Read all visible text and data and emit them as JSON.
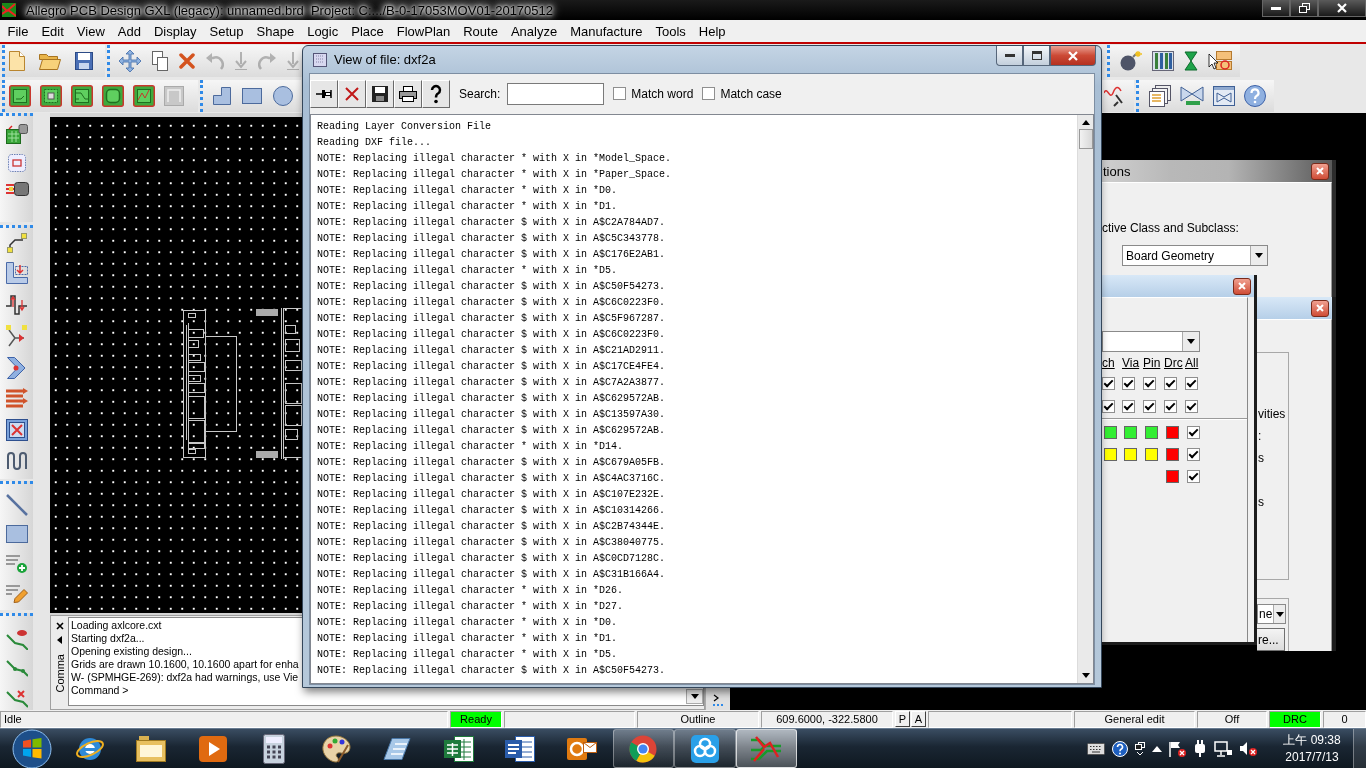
{
  "window": {
    "title": "Allegro PCB Design GXL (legacy): unnamed.brd  Project: C:.../B-0-17053MOV01-20170512"
  },
  "menu": [
    "File",
    "Edit",
    "View",
    "Add",
    "Display",
    "Setup",
    "Shape",
    "Logic",
    "Place",
    "FlowPlan",
    "Route",
    "Analyze",
    "Manufacture",
    "Tools",
    "Help"
  ],
  "edit_toolbar": [
    {
      "kind": "move",
      "disabled": false
    },
    {
      "kind": "copy",
      "disabled": false
    },
    {
      "kind": "delete",
      "disabled": false
    },
    {
      "kind": "undo",
      "disabled": true
    },
    {
      "kind": "step_back",
      "disabled": true
    },
    {
      "kind": "redo",
      "disabled": true
    },
    {
      "kind": "step_forward",
      "disabled": true
    }
  ],
  "viewer": {
    "title": "View of file: dxf2a",
    "search_label": "Search:",
    "options": [
      {
        "label": "Match word",
        "checked": false
      },
      {
        "label": "Match case",
        "checked": false
      }
    ],
    "lines": [
      "Reading Layer Conversion File",
      "Reading DXF file...",
      "NOTE: Replacing illegal character * with X in *Model_Space.",
      "NOTE: Replacing illegal character * with X in *Paper_Space.",
      "NOTE: Replacing illegal character * with X in *D0.",
      "NOTE: Replacing illegal character * with X in *D1.",
      "NOTE: Replacing illegal character $ with X in A$C2A784AD7.",
      "NOTE: Replacing illegal character $ with X in A$C5C343778.",
      "NOTE: Replacing illegal character $ with X in A$C176E2AB1.",
      "NOTE: Replacing illegal character * with X in *D5.",
      "NOTE: Replacing illegal character $ with X in A$C50F54273.",
      "NOTE: Replacing illegal character $ with X in A$C6C0223F0.",
      "NOTE: Replacing illegal character $ with X in A$C5F967287.",
      "NOTE: Replacing illegal character $ with X in A$C6C0223F0.",
      "NOTE: Replacing illegal character $ with X in A$C21AD2911.",
      "NOTE: Replacing illegal character $ with X in A$C17CE4FE4.",
      "NOTE: Replacing illegal character $ with X in A$C7A2A3877.",
      "NOTE: Replacing illegal character $ with X in A$C629572AB.",
      "NOTE: Replacing illegal character $ with X in A$C13597A30.",
      "NOTE: Replacing illegal character $ with X in A$C629572AB.",
      "NOTE: Replacing illegal character * with X in *D14.",
      "NOTE: Replacing illegal character $ with X in A$C679A05FB.",
      "NOTE: Replacing illegal character $ with X in A$C4AC3716C.",
      "NOTE: Replacing illegal character $ with X in A$C107E232E.",
      "NOTE: Replacing illegal character $ with X in A$C10314266.",
      "NOTE: Replacing illegal character $ with X in A$C2B74344E.",
      "NOTE: Replacing illegal character $ with X in A$C38040775.",
      "NOTE: Replacing illegal character $ with X in A$C0CD7128C.",
      "NOTE: Replacing illegal character $ with X in A$C31B166A4.",
      "NOTE: Replacing illegal character * with X in *D26.",
      "NOTE: Replacing illegal character * with X in *D27.",
      "NOTE: Replacing illegal character * with X in *D0.",
      "NOTE: Replacing illegal character * with X in *D1.",
      "NOTE: Replacing illegal character * with X in *D5.",
      "NOTE: Replacing illegal character $ with X in A$C50F54273."
    ]
  },
  "options_dialog": {
    "title": "tions",
    "prompt": "ctive Class and Subclass:",
    "class_value": "Board Geometry"
  },
  "visibility_dialog": {
    "columns": [
      "ch",
      "Via",
      "Pin",
      "Drc",
      "All"
    ],
    "check_rows": [
      [
        {
          "checked": true
        },
        {
          "checked": true
        },
        {
          "checked": true
        },
        {
          "checked": true
        },
        {
          "checked": true
        }
      ],
      [
        {
          "checked": true
        },
        {
          "checked": true
        },
        {
          "checked": true
        },
        {
          "checked": true
        },
        {
          "checked": true
        }
      ]
    ],
    "color_rows": [
      [
        {
          "kind": "swatch",
          "color": "#33ee33"
        },
        {
          "kind": "swatch",
          "color": "#33ee33"
        },
        {
          "kind": "swatch",
          "color": "#33ee33"
        },
        {
          "kind": "swatch",
          "color": "#ff0000"
        },
        {
          "kind": "check",
          "checked": true
        }
      ],
      [
        {
          "kind": "swatch",
          "color": "#ffff00"
        },
        {
          "kind": "swatch",
          "color": "#ffff00"
        },
        {
          "kind": "swatch",
          "color": "#ffff00"
        },
        {
          "kind": "swatch",
          "color": "#ff0000"
        },
        {
          "kind": "check",
          "checked": true
        }
      ],
      [
        {
          "kind": "swatch",
          "color": "#ff0000"
        },
        {
          "kind": "check",
          "checked": true
        }
      ]
    ]
  },
  "side_dialog": {
    "labels": [
      "vities",
      ":",
      "s",
      "s"
    ],
    "dropdown_value": "ne",
    "button": "re..."
  },
  "command_window": {
    "tab_label": "Comma",
    "lines": [
      "Loading axlcore.cxt",
      "Starting dxf2a...",
      "Opening existing design...",
      "Grids are drawn 10.1600, 10.1600 apart for enha",
      "W- (SPMHGE-269): dxf2a had warnings, use Vie",
      "Command >"
    ]
  },
  "status_bar": {
    "mode": "Idle",
    "state": {
      "text": "Ready",
      "color": "#00ff00"
    },
    "layer": "Outline",
    "coordinates": "609.6000, -322.5800",
    "keys": [
      "P",
      "A"
    ],
    "command": "General edit",
    "snap": "Off",
    "drc": {
      "text": "DRC",
      "color": "#00ff00"
    },
    "drc_count": "0"
  },
  "taskbar": {
    "apps": [
      {
        "kind": "browser",
        "running": false,
        "selected": false
      },
      {
        "kind": "folder",
        "running": false,
        "selected": false
      },
      {
        "kind": "player",
        "running": false,
        "selected": false
      },
      {
        "kind": "calculator",
        "running": false,
        "selected": false
      },
      {
        "kind": "palette",
        "running": false,
        "selected": false
      },
      {
        "kind": "notebook",
        "running": false,
        "selected": false
      },
      {
        "kind": "spreadsheet",
        "running": false,
        "selected": false
      },
      {
        "kind": "document",
        "running": false,
        "selected": false
      },
      {
        "kind": "mail",
        "running": false,
        "selected": false
      },
      {
        "kind": "chrome",
        "running": true,
        "selected": false
      },
      {
        "kind": "cloud",
        "running": true,
        "selected": false
      },
      {
        "kind": "circuit",
        "running": true,
        "selected": true
      }
    ],
    "clock": {
      "time": "上午 09:38",
      "date": "2017/7/13"
    }
  }
}
